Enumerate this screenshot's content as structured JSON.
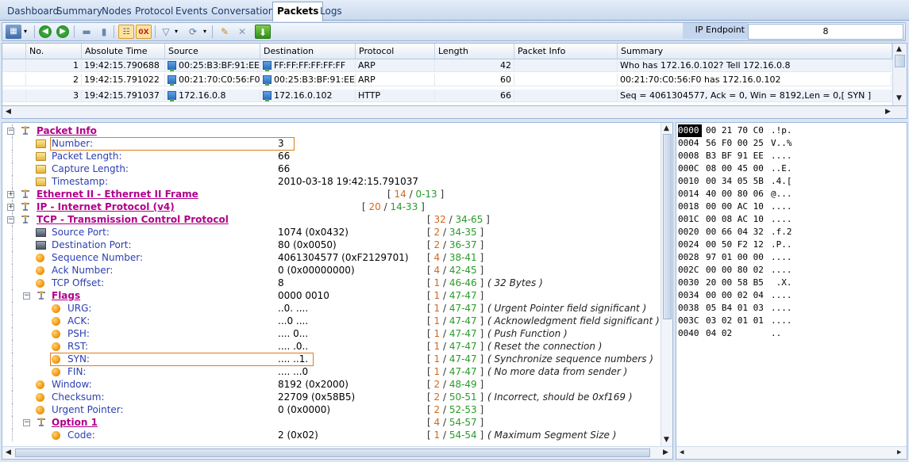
{
  "tabs": [
    "Dashboard",
    "Summary",
    "Nodes",
    "Protocol",
    "Events",
    "Conversations",
    "Packets",
    "Logs"
  ],
  "active_tab": "Packets",
  "toolbar": {
    "ip_endpoint_label": "IP Endpoint",
    "ip_endpoint_value": "8"
  },
  "grid": {
    "columns": [
      "No.",
      "Absolute Time",
      "Source",
      "Destination",
      "Protocol",
      "Length",
      "Packet Info",
      "Summary"
    ],
    "rows": [
      {
        "no": "1",
        "time": "19:42:15.790688",
        "source": "00:25:B3:BF:91:EE",
        "destination": "FF:FF:FF:FF:FF:FF",
        "protocol": "ARP",
        "length": "42",
        "info": "",
        "summary": "Who has 172.16.0.102? Tell 172.16.0.8"
      },
      {
        "no": "2",
        "time": "19:42:15.791022",
        "source": "00:21:70:C0:56:F0",
        "destination": "00:25:B3:BF:91:EE",
        "protocol": "ARP",
        "length": "60",
        "info": "",
        "summary": "00:21:70:C0:56:F0 has 172.16.0.102"
      },
      {
        "no": "3",
        "time": "19:42:15.791037",
        "source": "172.16.0.8",
        "destination": "172.16.0.102",
        "protocol": "HTTP",
        "length": "66",
        "info": "",
        "summary": "Seq = 4061304577, Ack = 0, Win = 8192,Len = 0,[ SYN ]"
      }
    ]
  },
  "tree": [
    {
      "type": "section",
      "label": "Packet Info",
      "expanded": true
    },
    {
      "type": "field",
      "label": "Number:",
      "value": "3"
    },
    {
      "type": "field",
      "label": "Packet Length:",
      "value": "66"
    },
    {
      "type": "field",
      "label": "Capture Length:",
      "value": "66"
    },
    {
      "type": "field",
      "label": "Timestamp:",
      "value": "2010-03-18 19:42:15.791037"
    },
    {
      "type": "section",
      "label": "Ethernet II - Ethernet II Frame",
      "expanded": false,
      "range_a": "14",
      "range_b": "0-13"
    },
    {
      "type": "section",
      "label": "IP - Internet Protocol (v4)",
      "expanded": false,
      "range_a": "20",
      "range_b": "14-33"
    },
    {
      "type": "section",
      "label": "TCP - Transmission Control Protocol",
      "expanded": true,
      "range_a": "32",
      "range_b": "34-65"
    },
    {
      "type": "net",
      "label": "Source Port:",
      "value": "1074 (0x0432)",
      "range_a": "2",
      "range_b": "34-35"
    },
    {
      "type": "net",
      "label": "Destination Port:",
      "value": "80 (0x0050)",
      "range_a": "2",
      "range_b": "36-37"
    },
    {
      "type": "ball",
      "label": "Sequence Number:",
      "value": "4061304577 (0xF2129701)",
      "range_a": "4",
      "range_b": "38-41"
    },
    {
      "type": "ball",
      "label": "Ack Number:",
      "value": "0 (0x00000000)",
      "range_a": "4",
      "range_b": "42-45"
    },
    {
      "type": "ball",
      "label": "TCP Offset:",
      "value": "8",
      "range_a": "1",
      "range_b": "46-46",
      "note": "( 32 Bytes )"
    },
    {
      "type": "subsection",
      "label": "Flags",
      "value": "0000 0010",
      "range_a": "1",
      "range_b": "47-47"
    },
    {
      "type": "flag",
      "label": "URG:",
      "value": "..0. ....",
      "range_a": "1",
      "range_b": "47-47",
      "note": "( Urgent Pointer field significant )"
    },
    {
      "type": "flag",
      "label": "ACK:",
      "value": "...0 ....",
      "range_a": "1",
      "range_b": "47-47",
      "note": "( Acknowledgment field significant )"
    },
    {
      "type": "flag",
      "label": "PSH:",
      "value": ".... 0...",
      "range_a": "1",
      "range_b": "47-47",
      "note": "( Push Function )"
    },
    {
      "type": "flag",
      "label": "RST:",
      "value": ".... .0..",
      "range_a": "1",
      "range_b": "47-47",
      "note": "( Reset the connection )"
    },
    {
      "type": "flag",
      "label": "SYN:",
      "value": ".... ..1.",
      "range_a": "1",
      "range_b": "47-47",
      "note": "( Synchronize sequence numbers )"
    },
    {
      "type": "flag",
      "label": "FIN:",
      "value": ".... ...0",
      "range_a": "1",
      "range_b": "47-47",
      "note": "( No more data from sender )"
    },
    {
      "type": "ball",
      "label": "Window:",
      "value": "8192 (0x2000)",
      "range_a": "2",
      "range_b": "48-49"
    },
    {
      "type": "ball",
      "label": "Checksum:",
      "value": "22709 (0x58B5)",
      "range_a": "2",
      "range_b": "50-51",
      "note": "( Incorrect, should be 0xf169 )"
    },
    {
      "type": "ball",
      "label": "Urgent Pointer:",
      "value": "0 (0x0000)",
      "range_a": "2",
      "range_b": "52-53"
    },
    {
      "type": "subsection",
      "label": "Option 1",
      "value": "",
      "range_a": "4",
      "range_b": "54-57"
    },
    {
      "type": "flag",
      "label": "Code:",
      "value": "2 (0x02)",
      "range_a": "1",
      "range_b": "54-54",
      "note": "( Maximum Segment Size )"
    }
  ],
  "hex": [
    {
      "off": "0000",
      "bytes": "00 21 70 C0",
      "ascii": ".!p."
    },
    {
      "off": "0004",
      "bytes": "56 F0 00 25",
      "ascii": "V..%"
    },
    {
      "off": "0008",
      "bytes": "B3 BF 91 EE",
      "ascii": "...."
    },
    {
      "off": "000C",
      "bytes": "08 00 45 00",
      "ascii": "..E."
    },
    {
      "off": "0010",
      "bytes": "00 34 05 5B",
      "ascii": ".4.["
    },
    {
      "off": "0014",
      "bytes": "40 00 80 06",
      "ascii": "@..."
    },
    {
      "off": "0018",
      "bytes": "00 00 AC 10",
      "ascii": "...."
    },
    {
      "off": "001C",
      "bytes": "00 08 AC 10",
      "ascii": "...."
    },
    {
      "off": "0020",
      "bytes": "00 66 04 32",
      "ascii": ".f.2"
    },
    {
      "off": "0024",
      "bytes": "00 50 F2 12",
      "ascii": ".P.."
    },
    {
      "off": "0028",
      "bytes": "97 01 00 00",
      "ascii": "...."
    },
    {
      "off": "002C",
      "bytes": "00 00 80 02",
      "ascii": "...."
    },
    {
      "off": "0030",
      "bytes": "20 00 58 B5",
      "ascii": " .X."
    },
    {
      "off": "0034",
      "bytes": "00 00 02 04",
      "ascii": "...."
    },
    {
      "off": "0038",
      "bytes": "05 B4 01 03",
      "ascii": "...."
    },
    {
      "off": "003C",
      "bytes": "03 02 01 01",
      "ascii": "...."
    },
    {
      "off": "0040",
      "bytes": "04 02",
      "ascii": ".."
    }
  ]
}
